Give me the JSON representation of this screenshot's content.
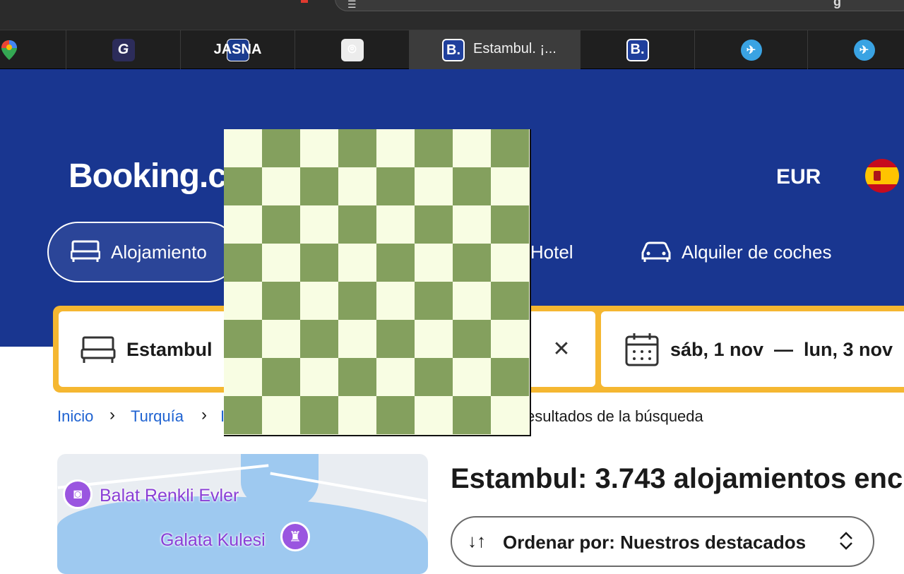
{
  "browser": {
    "tabs": [
      {
        "icon": "google-maps-icon",
        "title": ""
      },
      {
        "icon": "g-icon",
        "title": "",
        "glyph": "G"
      },
      {
        "icon": "jasna-icon",
        "title": "",
        "glyph": "JASNA"
      },
      {
        "icon": "chatgpt-icon",
        "title": "",
        "glyph": "⌾"
      },
      {
        "icon": "booking-icon",
        "title": "Estambul. ¡...",
        "glyph": "B."
      },
      {
        "icon": "booking-icon",
        "title": "",
        "glyph": "B."
      },
      {
        "icon": "plane-icon",
        "title": "",
        "glyph": "✈"
      },
      {
        "icon": "plane-icon",
        "title": "",
        "glyph": "✈"
      }
    ],
    "address_partial": "g"
  },
  "header": {
    "logo": "Booking.c",
    "currency": "EUR",
    "language_flag": "spain-flag-icon"
  },
  "nav": {
    "stays": "Alojamiento",
    "flight_hotel": "· Hotel",
    "car_rental": "Alquiler de coches"
  },
  "search": {
    "destination": "Estambul",
    "dates": "sáb, 1 nov  —  lun, 3 nov",
    "clear_glyph": "✕"
  },
  "breadcrumb": {
    "items": [
      "Inicio",
      "Turquía",
      "I"
    ],
    "current": "esultados de la búsqueda"
  },
  "map": {
    "pins": [
      {
        "label": "Balat Renkli Evler",
        "icon": "camera-icon",
        "glyph": "◙"
      },
      {
        "label": "Galata Kulesi",
        "icon": "tower-icon",
        "glyph": "♜"
      }
    ]
  },
  "results": {
    "title": "Estambul: 3.743 alojamientos enc",
    "sort_label": "Ordenar por: Nuestros destacados",
    "sort_icon": "↓↑",
    "sort_chevron": "⌃⌄"
  },
  "colors": {
    "brand": "#193690",
    "search_border": "#f5b731",
    "link": "#1e62d1",
    "chess_light": "#f8fde3",
    "chess_dark": "#84a05e"
  }
}
